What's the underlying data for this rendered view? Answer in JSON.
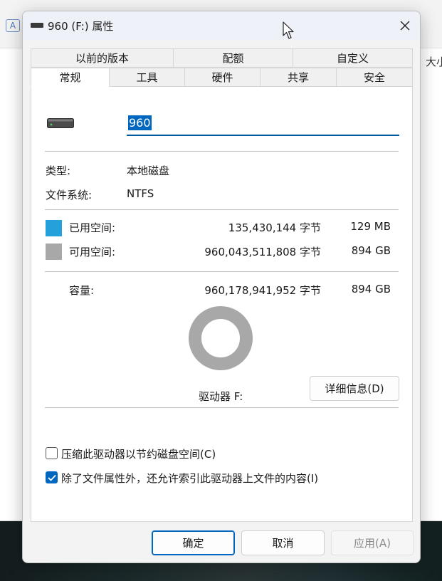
{
  "background": {
    "column_header": "大小"
  },
  "window": {
    "title": "960 (F:) 属性",
    "close_glyph": "✕"
  },
  "tabs": {
    "row1": [
      {
        "label": "以前的版本"
      },
      {
        "label": "配额"
      },
      {
        "label": "自定义"
      }
    ],
    "row2": [
      {
        "label": "常规"
      },
      {
        "label": "工具"
      },
      {
        "label": "硬件"
      },
      {
        "label": "共享"
      },
      {
        "label": "安全"
      }
    ],
    "active": "常规"
  },
  "general": {
    "drive_name_value": "960",
    "type_label": "类型:",
    "type_value": "本地磁盘",
    "fs_label": "文件系统:",
    "fs_value": "NTFS",
    "used": {
      "label": "已用空间:",
      "bytes": "135,430,144 字节",
      "size": "129 MB",
      "color": "#26a0da"
    },
    "free": {
      "label": "可用空间:",
      "bytes": "960,043,511,808 字节",
      "size": "894 GB",
      "color": "#a8a8a8"
    },
    "capacity": {
      "label": "容量:",
      "bytes": "960,178,941,952 字节",
      "size": "894 GB"
    },
    "usage_fraction": 0.000141,
    "drive_label": "驱动器 F:",
    "details_button": "详细信息(D)",
    "compress_label": "压缩此驱动器以节约磁盘空间(C)",
    "compress_checked": false,
    "index_label": "除了文件属性外，还允许索引此驱动器上文件的内容(I)",
    "index_checked": true
  },
  "footer": {
    "ok": "确定",
    "cancel": "取消",
    "apply": "应用(A)"
  }
}
